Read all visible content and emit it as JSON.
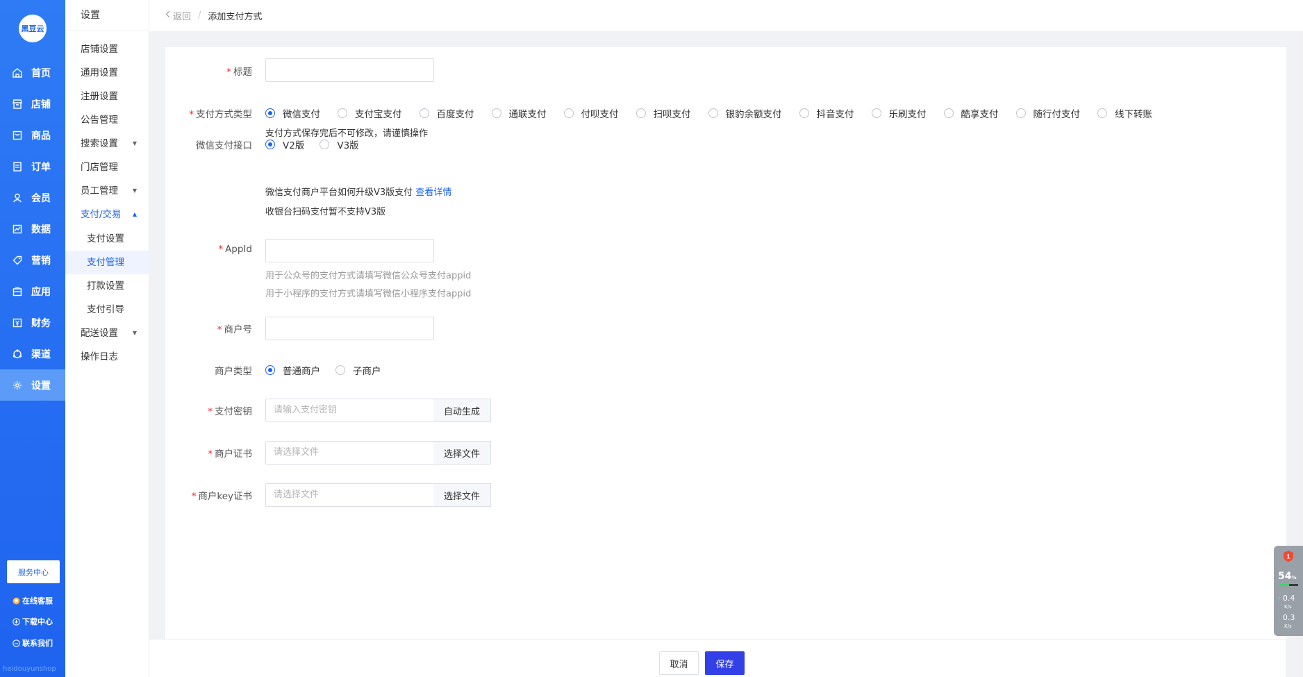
{
  "rail": {
    "logo_text": "黑豆云",
    "items": [
      {
        "label": "首页",
        "icon": "home-icon"
      },
      {
        "label": "店铺",
        "icon": "shop-icon"
      },
      {
        "label": "商品",
        "icon": "goods-icon"
      },
      {
        "label": "订单",
        "icon": "order-icon"
      },
      {
        "label": "会员",
        "icon": "member-icon"
      },
      {
        "label": "数据",
        "icon": "data-icon"
      },
      {
        "label": "营销",
        "icon": "tag-icon"
      },
      {
        "label": "应用",
        "icon": "app-icon"
      },
      {
        "label": "财务",
        "icon": "finance-icon"
      },
      {
        "label": "渠道",
        "icon": "channel-icon"
      },
      {
        "label": "设置",
        "icon": "gear-icon"
      }
    ],
    "service_center": "服务中心",
    "online_service": "在线客服",
    "download_center": "下载中心",
    "contact_us": "联系我们",
    "brand": "heidouyunshop",
    "accent": "#1e63ef"
  },
  "subnav": {
    "title": "设置",
    "items": [
      {
        "label": "店铺设置"
      },
      {
        "label": "通用设置"
      },
      {
        "label": "注册设置"
      },
      {
        "label": "公告管理"
      },
      {
        "label": "搜索设置"
      },
      {
        "label": "门店管理"
      },
      {
        "label": "员工管理"
      },
      {
        "label": "支付/交易"
      },
      {
        "label": "支付设置"
      },
      {
        "label": "支付管理"
      },
      {
        "label": "打款设置"
      },
      {
        "label": "支付引导"
      },
      {
        "label": "配送设置"
      },
      {
        "label": "操作日志"
      }
    ]
  },
  "breadcrumb": {
    "back": "返回",
    "separator": "/",
    "current": "添加支付方式"
  },
  "form": {
    "title": {
      "label": "标题",
      "value": ""
    },
    "pay_type": {
      "label": "支付方式类型",
      "options": [
        "微信支付",
        "支付宝支付",
        "百度支付",
        "通联支付",
        "付呗支付",
        "扫呗支付",
        "银豹余额支付",
        "抖音支付",
        "乐刷支付",
        "酷享支付",
        "随行付支付",
        "线下转账"
      ],
      "selected": "微信支付",
      "hint": "支付方式保存完后不可修改，请谨慎操作"
    },
    "wx_api": {
      "label": "微信支付接口",
      "options": [
        "V2版",
        "V3版"
      ],
      "selected": "V2版",
      "hint_text": "微信支付商户平台如何升级V3版支付",
      "hint_link": "查看详情",
      "hint2": "收银台扫码支付暂不支持V3版"
    },
    "appid": {
      "label": "AppId",
      "value": "",
      "hint1": "用于公众号的支付方式请填写微信公众号支付appid",
      "hint2": "用于小程序的支付方式请填写微信小程序支付appid"
    },
    "mch_id": {
      "label": "商户号",
      "value": ""
    },
    "mch_type": {
      "label": "商户类型",
      "options": [
        "普通商户",
        "子商户"
      ],
      "selected": "普通商户"
    },
    "pay_key": {
      "label": "支付密钥",
      "placeholder": "请输入支付密钥",
      "button": "自动生成"
    },
    "cert": {
      "label": "商户证书",
      "placeholder": "请选择文件",
      "button": "选择文件"
    },
    "key_cert": {
      "label": "商户key证书",
      "placeholder": "请选择文件",
      "button": "选择文件"
    }
  },
  "footer": {
    "cancel": "取消",
    "save": "保存",
    "save_color": "#3340e8"
  },
  "monitor": {
    "badge": "1",
    "percent": "54",
    "percent_unit": "%",
    "percent_level": 0.54,
    "up_speed": "0.4",
    "up_unit": "K/s",
    "down_speed": "0.3",
    "down_unit": "K/s"
  }
}
